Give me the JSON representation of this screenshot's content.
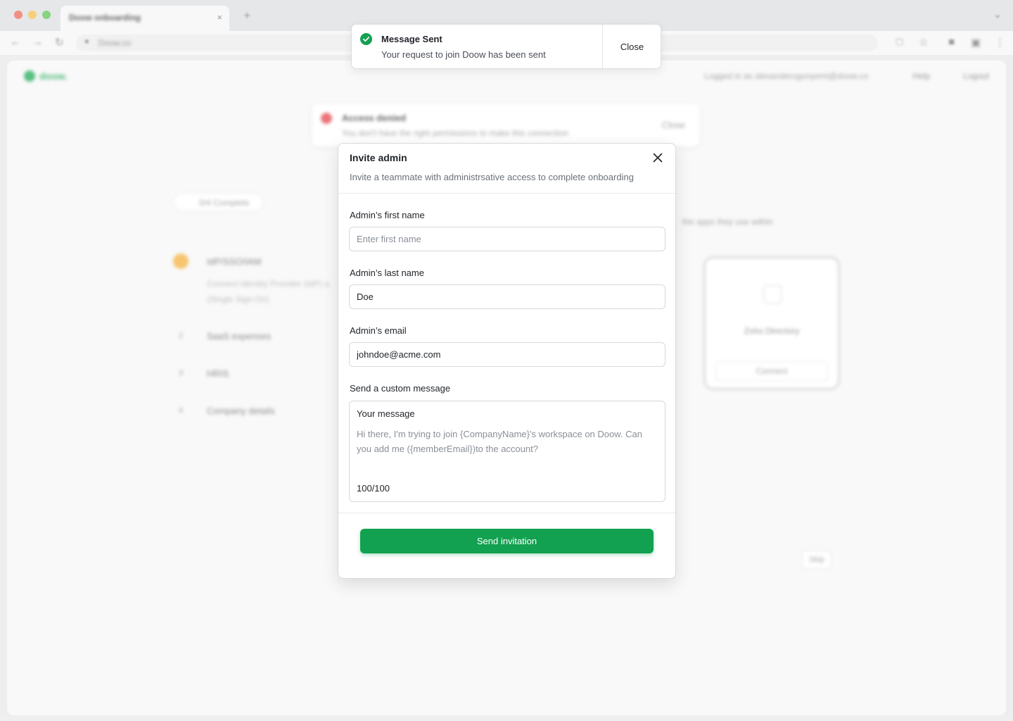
{
  "browser": {
    "tab_title": "Doow onboarding",
    "tab_close": "×",
    "new_tab": "+",
    "url": "Doow.co"
  },
  "app": {
    "logo_text": "doow.",
    "logged_in_text": "Logged in as alexanderogunyemi@doow.co",
    "help_label": "Help",
    "logout_label": "Logout",
    "brand_color": "#1faa57"
  },
  "bg_toast": {
    "title": "Access denied",
    "message": "You don't have the right permissions to make this connection",
    "close_label": "Close"
  },
  "onboarding": {
    "progress": "0/4 Complete",
    "description": "the apps they use within",
    "steps": [
      {
        "num": "1",
        "label": "IdP/SSO/IAM",
        "sub1": "Connect Identity Provider (IdP) a",
        "sub2": "(Single Sign-On)"
      },
      {
        "num": "2",
        "label": "SaaS expenses"
      },
      {
        "num": "3",
        "label": "HRIS"
      },
      {
        "num": "4",
        "label": "Company details"
      }
    ],
    "zoho_title": "Zoho Directory",
    "zoho_connect": "Connect",
    "skip_label": "Skip"
  },
  "modal": {
    "title": "Invite admin",
    "subtitle": "Invite a teammate with administrsative access to complete onboarding",
    "first_name_label": "Admin’s first name",
    "first_name_placeholder": "Enter first name",
    "first_name_value": "",
    "last_name_label": "Admin’s last name",
    "last_name_value": "Doe",
    "email_label": "Admin’s email",
    "email_value": "johndoe@acme.com",
    "custom_message_label": "Send a custom message",
    "message_box_label": "Your message",
    "message_text": "Hi there, I'm trying to join {CompanyName}'s workspace on Doow. Can you add me ({memberEmail})to the account?",
    "char_count": "100/100",
    "send_label": "Send invitation",
    "send_color": "#12a150"
  },
  "toast": {
    "title": "Message Sent",
    "message": "Your request to join Doow has been sent",
    "close_label": "Close",
    "success_color": "#12a150"
  }
}
